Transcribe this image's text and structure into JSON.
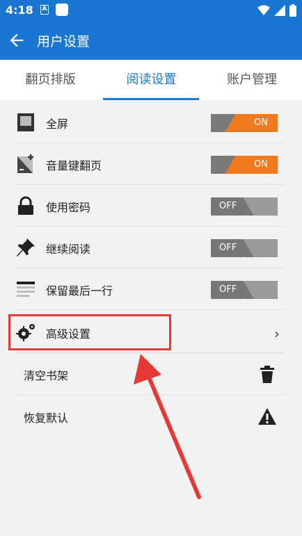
{
  "status": {
    "time": "4:18",
    "a_badge": "A"
  },
  "app_bar": {
    "title": "用户设置"
  },
  "tabs": [
    {
      "label": "翻页排版"
    },
    {
      "label": "阅读设置"
    },
    {
      "label": "账户管理"
    }
  ],
  "settings": [
    {
      "label": "全屏",
      "toggle": "ON",
      "icon": "fullscreen-icon"
    },
    {
      "label": "音量键翻页",
      "toggle": "ON",
      "icon": "volume-page-icon"
    },
    {
      "label": "使用密码",
      "toggle": "OFF",
      "icon": "lock-icon"
    },
    {
      "label": "继续阅读",
      "toggle": "OFF",
      "icon": "pin-icon"
    },
    {
      "label": "保留最后一行",
      "toggle": "OFF",
      "icon": "lines-icon"
    },
    {
      "label": "高级设置",
      "icon": "gear-icon"
    }
  ],
  "actions": [
    {
      "label": "清空书架",
      "icon": "trash-icon"
    },
    {
      "label": "恢复默认",
      "icon": "warning-icon"
    }
  ],
  "colors": {
    "primary": "#1976d2",
    "toggle_on": "#f07a1f",
    "annotation": "#e53935"
  }
}
